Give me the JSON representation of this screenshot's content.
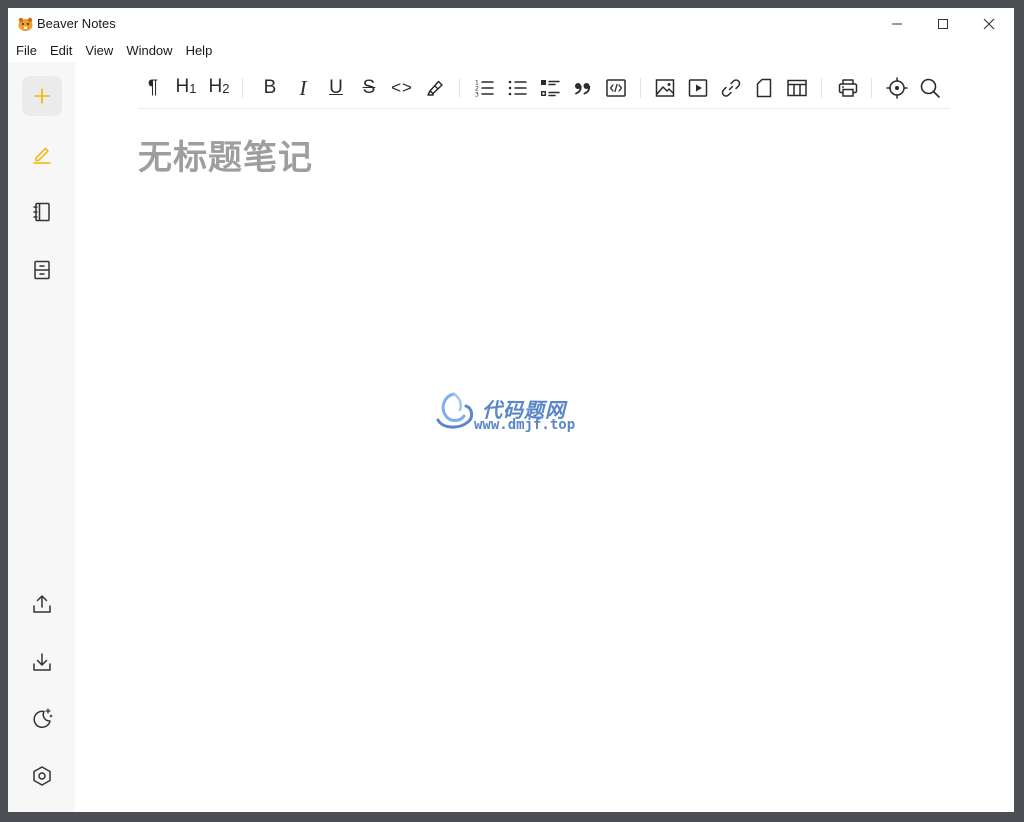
{
  "window": {
    "title": "Beaver Notes",
    "controls": {
      "minimize": "minimize-icon",
      "maximize": "maximize-icon",
      "close": "close-icon"
    }
  },
  "menu": [
    "File",
    "Edit",
    "View",
    "Window",
    "Help"
  ],
  "sidebar": {
    "top": [
      {
        "name": "new-note",
        "icon": "plus-icon",
        "color": "#f5b400"
      },
      {
        "name": "notes",
        "icon": "pencil-icon",
        "color": "#f5b400",
        "active": true
      },
      {
        "name": "notebooks",
        "icon": "notebook-icon"
      },
      {
        "name": "archive",
        "icon": "archive-icon"
      }
    ],
    "bottom": [
      {
        "name": "export",
        "icon": "upload-icon"
      },
      {
        "name": "import",
        "icon": "download-icon"
      },
      {
        "name": "theme",
        "icon": "moon-icon"
      },
      {
        "name": "settings",
        "icon": "hexagon-settings-icon"
      }
    ]
  },
  "toolbar": {
    "paragraph": "¶",
    "h1": "H",
    "h1_sub": "1",
    "h2": "H",
    "h2_sub": "2",
    "bold": "B",
    "italic": "I",
    "underline": "U",
    "strike": "S",
    "code": "<>"
  },
  "note": {
    "title": "无标题笔记"
  },
  "watermark": {
    "name": "代码题网",
    "url": "www.dmjf.top",
    "color": "#5b86c9"
  },
  "colors": {
    "accent": "#f5b400",
    "sidebar_bg": "#f7f7f7",
    "title_placeholder": "#9e9e9e"
  }
}
